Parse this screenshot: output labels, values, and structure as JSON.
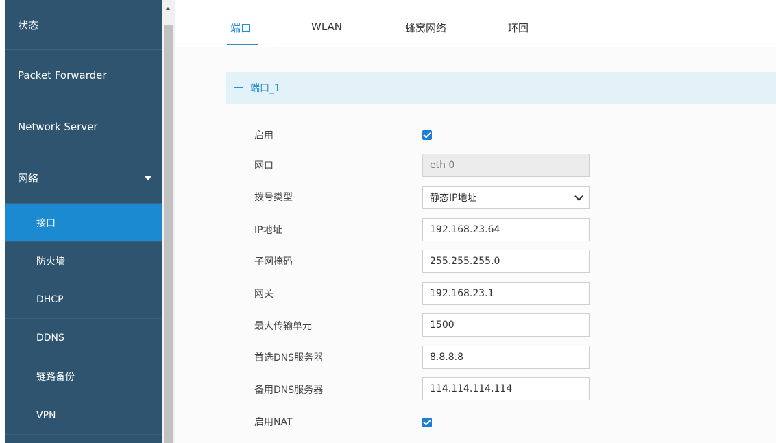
{
  "sidebar": {
    "items": [
      {
        "label": "状态"
      },
      {
        "label": "Packet Forwarder"
      },
      {
        "label": "Network Server"
      },
      {
        "label": "网络"
      }
    ],
    "sub_items": [
      {
        "label": "接口"
      },
      {
        "label": "防火墙"
      },
      {
        "label": "DHCP"
      },
      {
        "label": "DDNS"
      },
      {
        "label": "链路备份"
      },
      {
        "label": "VPN"
      }
    ]
  },
  "tabs": [
    {
      "label": "端口"
    },
    {
      "label": "WLAN"
    },
    {
      "label": "蜂窝网络"
    },
    {
      "label": "环回"
    }
  ],
  "panel": {
    "title": "端口_1"
  },
  "form": {
    "enable_label": "启用",
    "enable_checked": true,
    "interface_label": "网口",
    "interface_value": "eth 0",
    "dial_type_label": "拨号类型",
    "dial_type_value": "静态IP地址",
    "ip_label": "IP地址",
    "ip_value": "192.168.23.64",
    "mask_label": "子网掩码",
    "mask_value": "255.255.255.0",
    "gateway_label": "网关",
    "gateway_value": "192.168.23.1",
    "mtu_label": "最大传输单元",
    "mtu_value": "1500",
    "dns1_label": "首选DNS服务器",
    "dns1_value": "8.8.8.8",
    "dns2_label": "备用DNS服务器",
    "dns2_value": "114.114.114.114",
    "nat_label": "启用NAT",
    "nat_checked": true
  },
  "colors": {
    "sidebar_bg": "#2f5470",
    "sidebar_active": "#1c8ad1",
    "accent": "#2a8fcf",
    "panel_header_bg": "#e3f1f9"
  }
}
